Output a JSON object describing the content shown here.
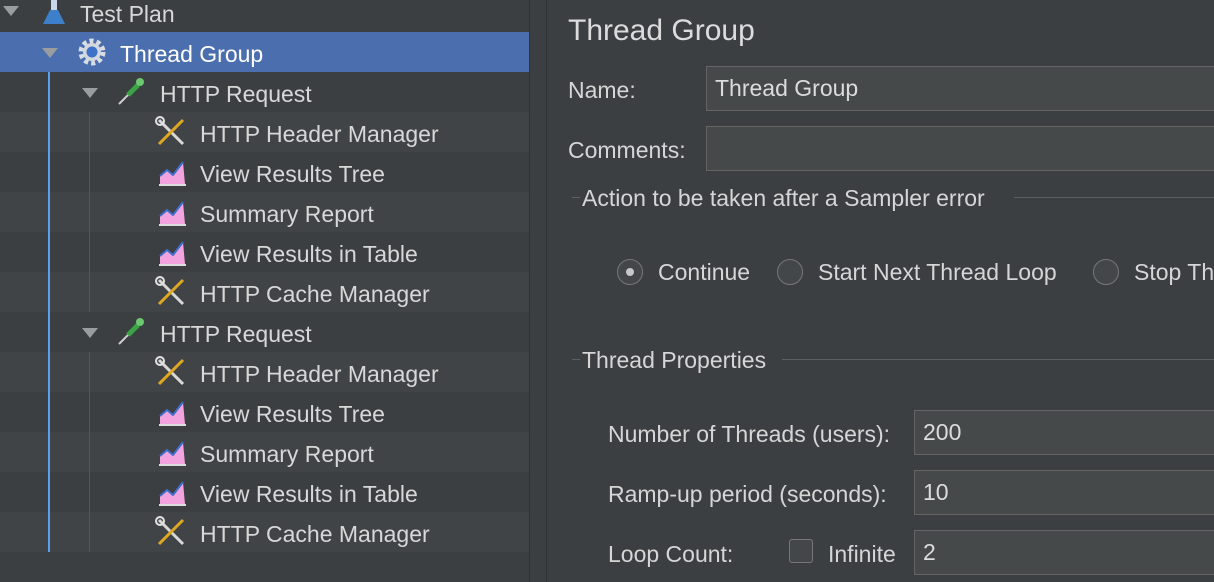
{
  "tree": {
    "items": [
      {
        "label": "Test Plan",
        "icon": "test-plan-icon"
      },
      {
        "label": "Thread Group",
        "icon": "thread-group-gear-icon"
      },
      {
        "label": "HTTP Request",
        "icon": "http-request-pipette-icon"
      },
      {
        "label": "HTTP Header Manager",
        "icon": "config-tools-icon"
      },
      {
        "label": "View Results Tree",
        "icon": "listener-graph-icon"
      },
      {
        "label": "Summary Report",
        "icon": "listener-graph-icon"
      },
      {
        "label": "View Results in Table",
        "icon": "listener-graph-icon"
      },
      {
        "label": "HTTP Cache Manager",
        "icon": "config-tools-icon"
      },
      {
        "label": "HTTP Request",
        "icon": "http-request-pipette-icon"
      },
      {
        "label": "HTTP Header Manager",
        "icon": "config-tools-icon"
      },
      {
        "label": "View Results Tree",
        "icon": "listener-graph-icon"
      },
      {
        "label": "Summary Report",
        "icon": "listener-graph-icon"
      },
      {
        "label": "View Results in Table",
        "icon": "listener-graph-icon"
      },
      {
        "label": "HTTP Cache Manager",
        "icon": "config-tools-icon"
      }
    ],
    "selected_label": "Thread Group",
    "selection_color": "#4b6eaf"
  },
  "panel": {
    "title": "Thread Group",
    "name_label": "Name:",
    "name_value": "Thread Group",
    "comments_label": "Comments:",
    "comments_value": "",
    "action_section": "Action to be taken after a Sampler error",
    "radio_options": [
      "Continue",
      "Start Next Thread Loop",
      "Stop Th"
    ],
    "radio_selected": "Continue",
    "thread_section": "Thread Properties",
    "threads_label": "Number of Threads (users):",
    "threads_value": "200",
    "rampup_label": "Ramp-up period (seconds):",
    "rampup_value": "10",
    "loop_label": "Loop Count:",
    "infinite_label": "Infinite",
    "infinite_checked": false,
    "loop_value": "2"
  }
}
